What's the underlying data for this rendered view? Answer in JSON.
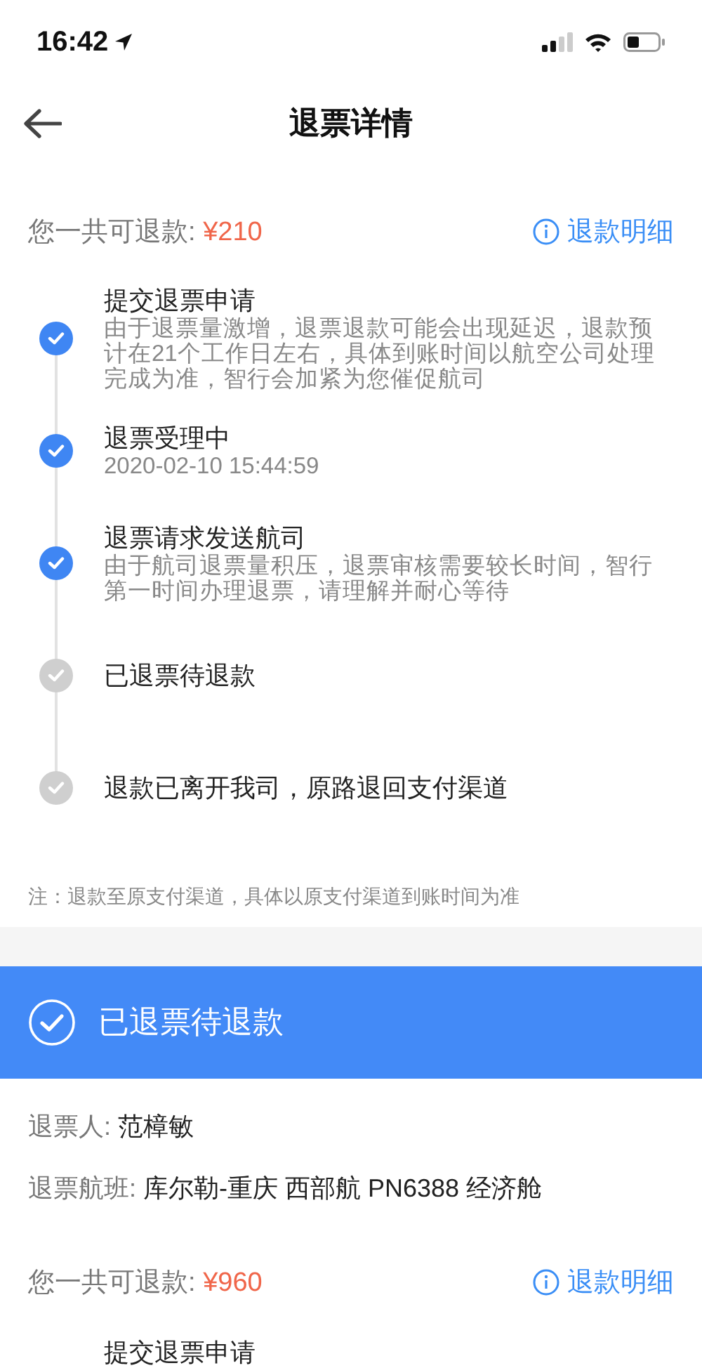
{
  "status_bar": {
    "time": "16:42"
  },
  "nav": {
    "title": "退票详情"
  },
  "blocks": [
    {
      "kind": "refund",
      "label": "您一共可退款: ",
      "amount": "¥210",
      "link": "退款明细",
      "steps": [
        {
          "title": "提交退票申请",
          "detail": "由于退票量激增，退票退款可能会出现延迟，退款预计在21个工作日左右，具体到账时间以航空公司处理完成为准，智行会加紧为您催促航司",
          "done": true
        },
        {
          "title": "退票受理中",
          "detail": "2020-02-10 15:44:59",
          "done": true
        },
        {
          "title": "退票请求发送航司",
          "detail": "由于航司退票量积压，退票审核需要较长时间，智行第一时间办理退票，请理解并耐心等待",
          "done": true
        },
        {
          "title": "已退票待退款",
          "done": false
        },
        {
          "title": "退款已离开我司，原路退回支付渠道",
          "done": false
        }
      ],
      "note": "注：退款至原支付渠道，具体以原支付渠道到账时间为准"
    },
    {
      "kind": "ticket",
      "status": "已退票待退款",
      "passenger_label": "退票人: ",
      "passenger": "范樟敏",
      "flight_label": "退票航班: ",
      "flight": "库尔勒-重庆 西部航 PN6388 经济舱"
    },
    {
      "kind": "refund",
      "label": "您一共可退款: ",
      "amount": "¥960",
      "link": "退款明细",
      "steps": [
        {
          "title": "提交退票申请"
        }
      ]
    }
  ]
}
